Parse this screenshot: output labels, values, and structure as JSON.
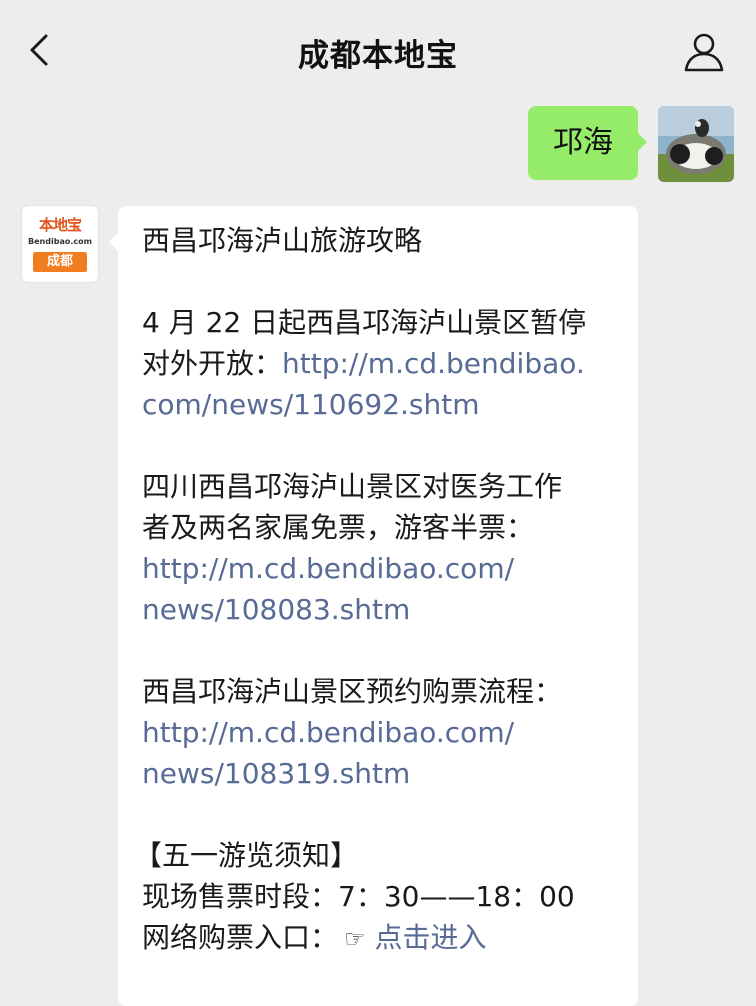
{
  "header": {
    "title": "成都本地宝",
    "back_icon": "chevron-left-icon",
    "profile_icon": "person-icon"
  },
  "outgoing": {
    "text": "邛海"
  },
  "brand_avatar": {
    "line1": "本地宝",
    "line2": "Bendibao.com",
    "line3": "成都"
  },
  "message": {
    "title": "西昌邛海泸山旅游攻略",
    "p1_text_line1": "4 月 22 日起西昌邛海泸山景区暂停",
    "p1_text_line2": "对外开放：",
    "p1_link_part1": "http://m.cd.bendibao.",
    "p1_link_part2": "com/news/110692.shtm",
    "p2_text_line1": "四川西昌邛海泸山景区对医务工作",
    "p2_text_line2": "者及两名家属免票，游客半票：",
    "p2_link_part1": "http://m.cd.bendibao.com/",
    "p2_link_part2": "news/108083.shtm",
    "p3_text": "西昌邛海泸山景区预约购票流程：",
    "p3_link_part1": "http://m.cd.bendibao.com/",
    "p3_link_part2": "news/108319.shtm",
    "notice_title": "【五一游览须知】",
    "notice_hours": "现场售票时段：7：30——18：00",
    "notice_online_label": "网络购票入口：",
    "notice_online_icon": "pointing-hand-icon",
    "notice_online_link": "点击进入"
  },
  "colors": {
    "background": "#ededed",
    "outgoing_bubble": "#95ec69",
    "incoming_bubble": "#ffffff",
    "link": "#576b95",
    "brand_orange": "#f07d1f"
  }
}
